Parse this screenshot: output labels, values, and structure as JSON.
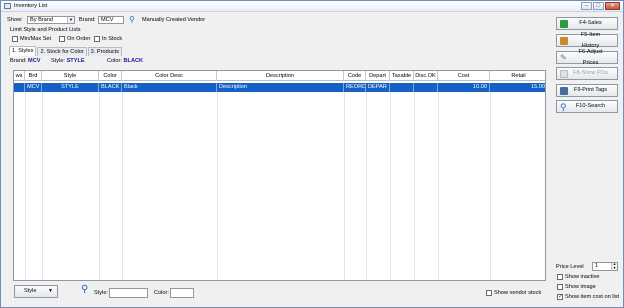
{
  "window": {
    "title": "Inventory List"
  },
  "filters": {
    "show_label": "Show:",
    "show_value": "By Brand",
    "brand_label": "Brand:",
    "brand_value": "MCV",
    "brand_name": "Manually Created Vendor",
    "limit_label": "Limit Style and Product Lists",
    "minmax_label": "Min/Max Set",
    "onorder_label": "On Order",
    "instock_label": "In Stock"
  },
  "tabs": [
    {
      "label": "1. Styles"
    },
    {
      "label": "2. Stock for Color"
    },
    {
      "label": "3. Products"
    }
  ],
  "info": {
    "brand_label": "Brand:",
    "brand_value": "MCV",
    "style_label": "Style:",
    "style_value": "STYLE",
    "color_label": "Color:",
    "color_value": "BLACK"
  },
  "grid": {
    "columns": [
      "ws",
      "Brd",
      "Style",
      "Color",
      "Color Desc",
      "Description",
      "Code",
      "Depart",
      "Taxable",
      "Disc.OK",
      "Cost",
      "Retail"
    ],
    "rows": [
      [
        "",
        "MCV",
        "STYLE",
        "BLACK",
        "Black",
        "Description",
        "REORD",
        "DEPAR",
        "",
        "",
        "10.00",
        "15.00"
      ]
    ]
  },
  "bottom": {
    "style_button": "Style",
    "style_label": "Style:",
    "color_label": "Color:",
    "show_vendor_stock": "Show vendor stock"
  },
  "actions": [
    {
      "label": "F4-Sales",
      "icon": "sales-icon",
      "color": "#2e9a3e",
      "disabled": false
    },
    {
      "label": "F5-Item History",
      "icon": "history-icon",
      "color": "#c98a2b",
      "disabled": false
    },
    {
      "label": "F6-Adjust Prices",
      "icon": "pencil-icon",
      "color": "#6a6f76",
      "disabled": false
    },
    {
      "label": "F8-Show POs",
      "icon": "po-icon",
      "color": "#b8bcc2",
      "disabled": true
    },
    {
      "label": "F9-Print Tags",
      "icon": "tags-icon",
      "color": "#4b6b9a",
      "disabled": false
    },
    {
      "label": "F10-Search",
      "icon": "search-icon",
      "color": "#2c63b8",
      "disabled": false
    }
  ],
  "side_options": {
    "price_level_label": "Price Level",
    "price_level_value": "1",
    "show_inactive": "Show inactive",
    "show_image": "Show image",
    "show_item_cost": "Show item cost on list"
  },
  "colors": {
    "selection": "#1560c4",
    "info_value": "#1a1aa0"
  }
}
